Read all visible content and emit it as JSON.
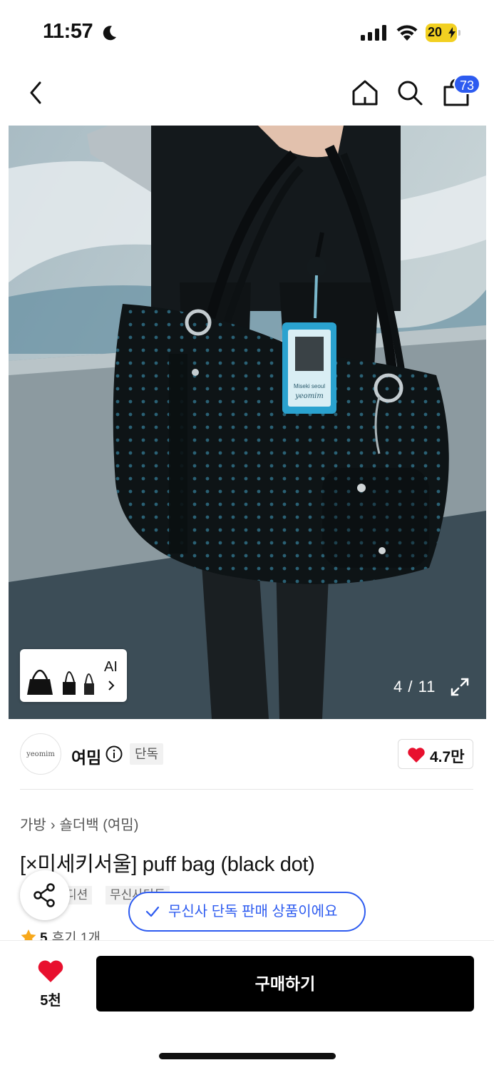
{
  "status_bar": {
    "time": "11:57",
    "battery": "20"
  },
  "nav": {
    "cart_count": "73"
  },
  "gallery": {
    "thumbnail_label": "AI",
    "counter": "4 / 11",
    "id_card_brand": "Miseki seoul",
    "id_card_logo": "yeomim"
  },
  "brand": {
    "logo_text": "yeomim",
    "name": "여밈",
    "exclusive_tag": "단독",
    "likes": "4.7만"
  },
  "product": {
    "breadcrumb": [
      "가방",
      "숄더백 (여밈)"
    ],
    "title": "[×미세키서울] puff bag (black dot)",
    "chips": [
      "디션",
      "무신사단독"
    ],
    "rating_score": "5",
    "review_count": "후기 1개"
  },
  "toast": {
    "text": "무신사 단독 판매 상품이에요"
  },
  "bottom_bar": {
    "wish_count": "5천",
    "buy_label": "구매하기"
  },
  "colors": {
    "accent_blue": "#2d5bf0",
    "heart_red": "#e8102e",
    "star": "#f7a81b"
  }
}
